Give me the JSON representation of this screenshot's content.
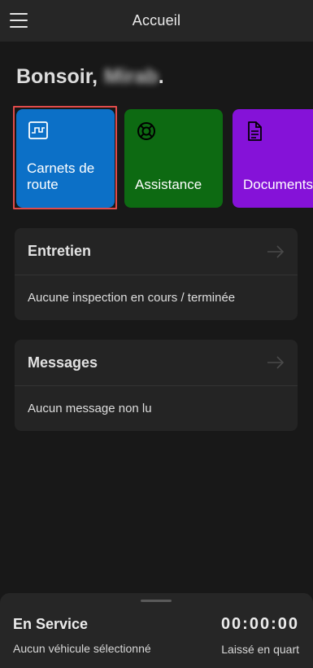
{
  "header": {
    "title": "Accueil",
    "menu_icon": "hamburger-menu-icon"
  },
  "greeting": {
    "salutation": "Bonsoir,",
    "user_name": "Mirab",
    "punctuation": "."
  },
  "tiles": [
    {
      "label": "Carnets de route",
      "icon": "logbook-chart-icon",
      "color": "#0c70c7",
      "selected": true
    },
    {
      "label": "Assistance",
      "icon": "lifebuoy-icon",
      "color": "#0d6a12",
      "selected": false
    },
    {
      "label": "Documents",
      "icon": "document-icon",
      "color": "#8512d8",
      "selected": false
    }
  ],
  "cards": {
    "entretien": {
      "title": "Entretien",
      "text": "Aucune inspection en cours / terminée"
    },
    "messages": {
      "title": "Messages",
      "text": "Aucun message non lu"
    }
  },
  "service": {
    "title": "En Service",
    "vehicle_text": "Aucun véhicule sélectionné",
    "timer": "00:00:00",
    "status": "Laissé en quart"
  },
  "colors": {
    "background": "#181818",
    "surface": "#242424",
    "focus_ring": "#e04b4b"
  }
}
